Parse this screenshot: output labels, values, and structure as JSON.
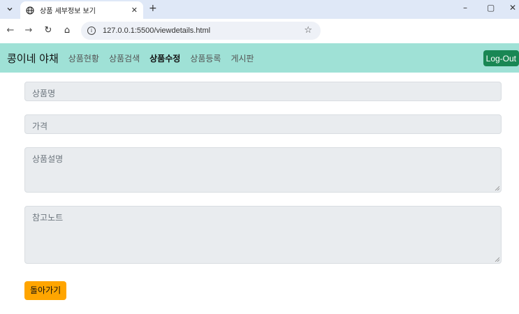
{
  "browser": {
    "tab_title": "상품 세부정보 보기",
    "url": "127.0.0.1:5500/viewdetails.html"
  },
  "nav": {
    "brand": "콩이네 야채",
    "links": [
      "상품현황",
      "상품검색",
      "상품수정",
      "상품등록",
      "게시판"
    ],
    "active_index": 2,
    "logout_label": "Log-Out",
    "bg_color": "#9fe1d6",
    "logout_color": "#198754"
  },
  "form": {
    "name_placeholder": "상품명",
    "price_placeholder": "가격",
    "description_placeholder": "상품설명",
    "note_placeholder": "참고노트"
  },
  "back_button": {
    "label": "돌아가기",
    "color": "#ffa500"
  }
}
